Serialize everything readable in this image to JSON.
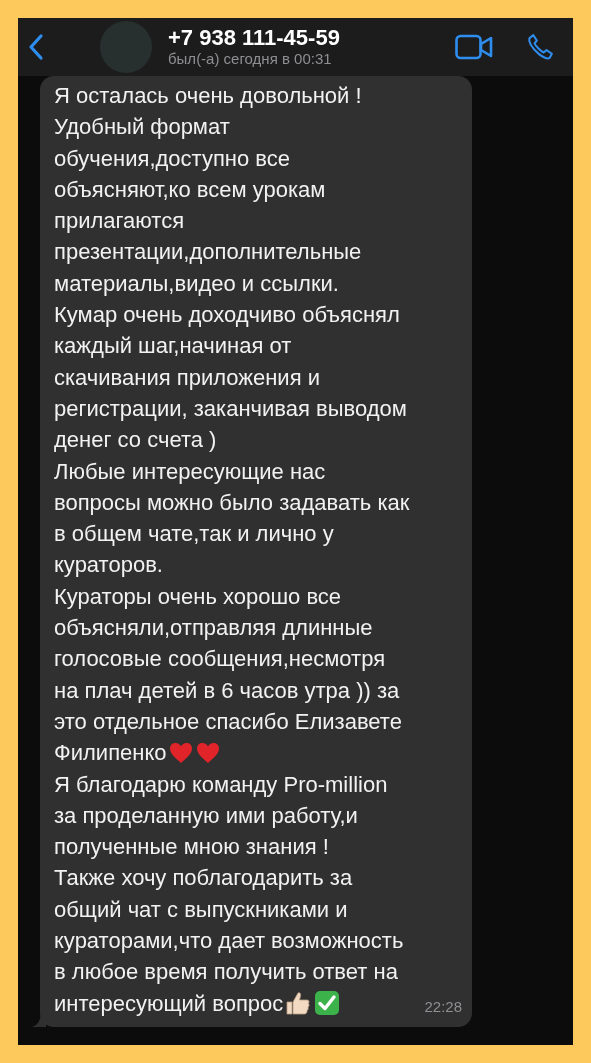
{
  "header": {
    "contact": "+7 938 111-45-59",
    "status": "был(-а) сегодня в 00:31"
  },
  "message": {
    "time": "22:28",
    "lines": [
      {
        "text": "Я осталась очень довольной !"
      },
      {
        "text": "Удобный формат"
      },
      {
        "text": "обучения,доступно все"
      },
      {
        "text": "объясняют,ко всем урокам"
      },
      {
        "text": "прилагаются"
      },
      {
        "text": "презентации,дополнительные"
      },
      {
        "text": "материалы,видео и ссылки."
      },
      {
        "text": "Кумар очень доходчиво объяснял"
      },
      {
        "text": "каждый шаг,начиная от"
      },
      {
        "text": "скачивания приложения и"
      },
      {
        "text": "регистрации, заканчивая выводом"
      },
      {
        "text": "денег со счета )"
      },
      {
        "text": "Любые интересующие нас"
      },
      {
        "text": "вопросы можно было задавать как"
      },
      {
        "text": "в общем чате,так и лично у"
      },
      {
        "text": "кураторов."
      },
      {
        "text": "Кураторы очень хорошо все"
      },
      {
        "text": "объясняли,отправляя длинные"
      },
      {
        "text": "голосовые сообщения,несмотря"
      },
      {
        "text": "на плач детей в 6 часов утра )) за"
      },
      {
        "text": "это отдельное спасибо Елизавете"
      },
      {
        "text": "Филипенко",
        "icons": [
          {
            "kind": "heart"
          },
          {
            "kind": "heart"
          }
        ]
      },
      {
        "text": "Я благодарю команду Pro-million"
      },
      {
        "text": "за проделанную ими работу,и"
      },
      {
        "text": "полученные мною знания !"
      },
      {
        "text": "Также хочу поблагодарить за"
      },
      {
        "text": "общий чат с выпускниками и"
      },
      {
        "text": "кураторами,что дает возможность"
      },
      {
        "text": "в любое время получить ответ на"
      },
      {
        "text": "интересующий вопрос",
        "icons": [
          {
            "kind": "thumbs-up"
          },
          {
            "kind": "check"
          }
        ]
      }
    ]
  }
}
